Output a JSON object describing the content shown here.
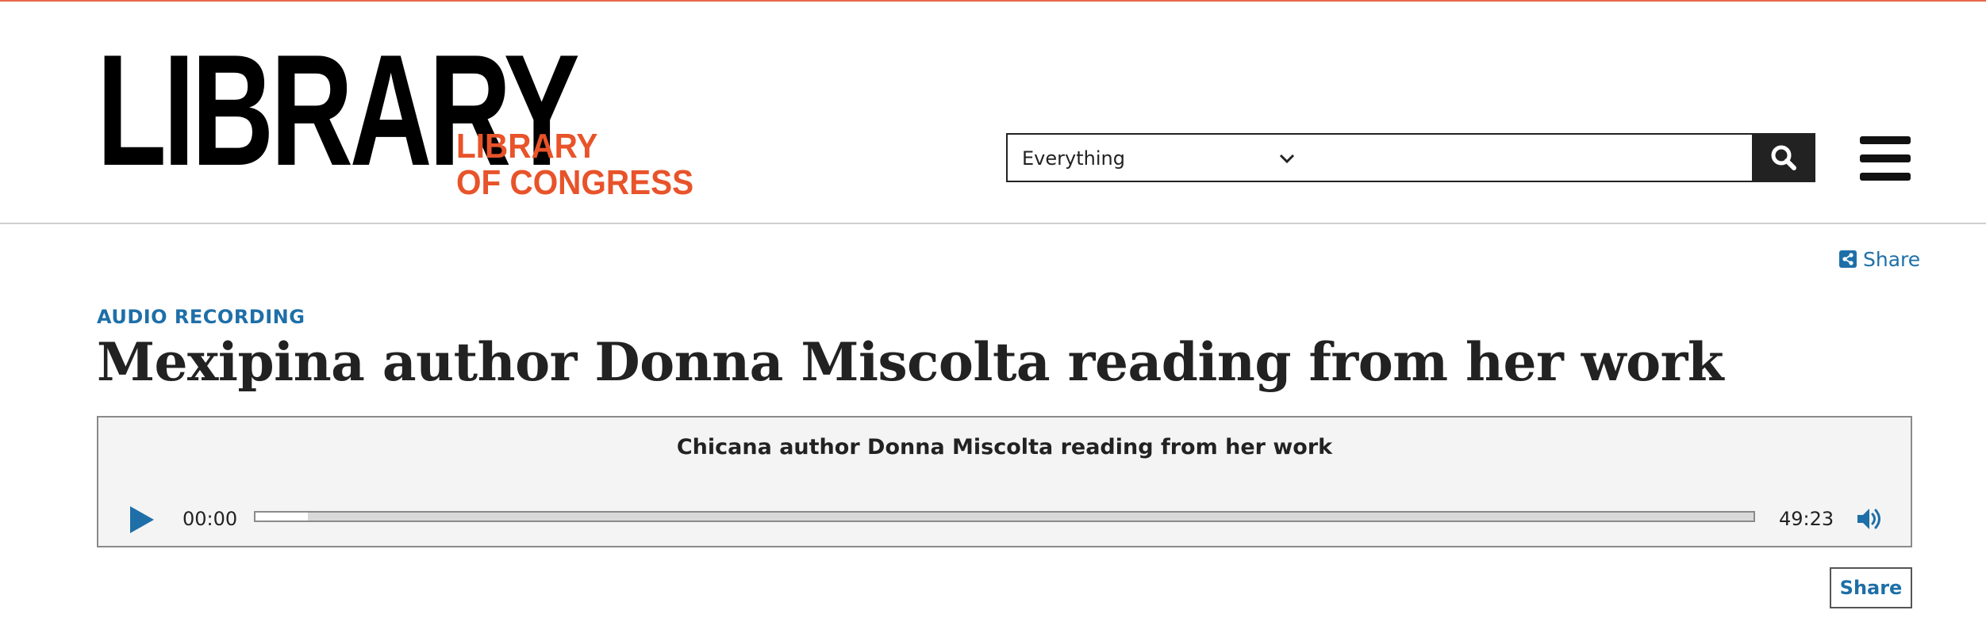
{
  "logo": {
    "big_text": "LIBRARY",
    "sub_line1": "LIBRARY",
    "sub_line2": "OF CONGRESS",
    "big_color": "#000000",
    "sub_color": "#e8532a"
  },
  "search": {
    "scope_selected": "Everything",
    "query_value": "",
    "button_icon": "search-icon"
  },
  "menu": {
    "icon": "hamburger-menu-icon"
  },
  "share_top": {
    "label": "Share",
    "icon": "share-icon"
  },
  "item": {
    "format_label": "AUDIO RECORDING",
    "title": "Mexipina author Donna Miscolta reading from her work"
  },
  "player": {
    "track_title": "Chicana author Donna Miscolta reading from her work",
    "current_time": "00:00",
    "total_time": "49:23",
    "buffered_fraction": 0.035,
    "play_icon": "play-icon",
    "volume_icon": "volume-icon"
  },
  "share_bottom": {
    "label": "Share"
  },
  "colors": {
    "accent": "#e8532a",
    "link": "#1e6fa8",
    "dark": "#222222"
  }
}
